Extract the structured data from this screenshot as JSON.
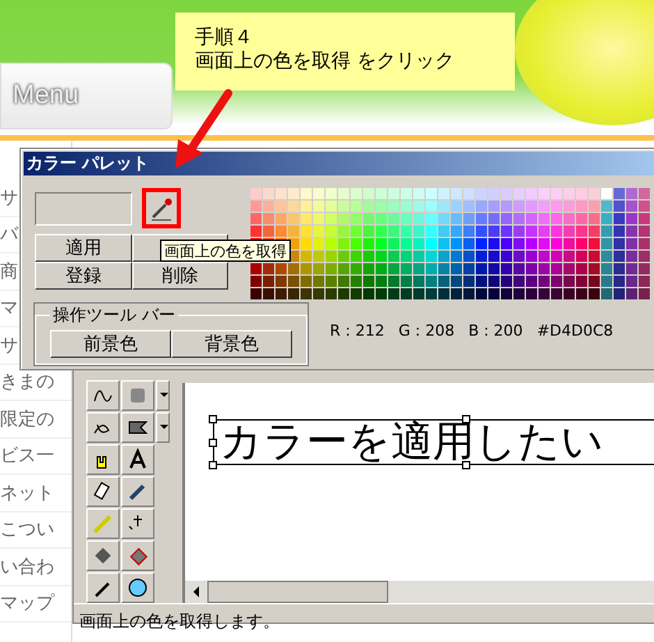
{
  "site": {
    "menu_label": "Menu",
    "sidebar_items": [
      "サ",
      "バ",
      "商",
      "マ",
      "サ",
      "きまの",
      "限定の",
      "ビス一",
      "ネット",
      "こつい",
      "い合わ",
      "マップ"
    ]
  },
  "callout": {
    "step": "手順４",
    "instruction": "画面上の色を取得 をクリック"
  },
  "palette_dialog": {
    "title": "カラー パレット",
    "buttons": [
      "適用",
      "登録",
      "削除"
    ],
    "tooltip": "画面上の色を取得",
    "group": {
      "label": "操作ツール バー",
      "buttons": [
        "前景色",
        "背景色"
      ]
    },
    "readout": {
      "r": "R : 212",
      "g": "G : 208",
      "b": "B : 200",
      "hex": "#D4D0C8"
    },
    "picker_highlighted": true
  },
  "editor": {
    "text_box": "カラーを適用したい",
    "status": "画面上の色を取得します。"
  }
}
